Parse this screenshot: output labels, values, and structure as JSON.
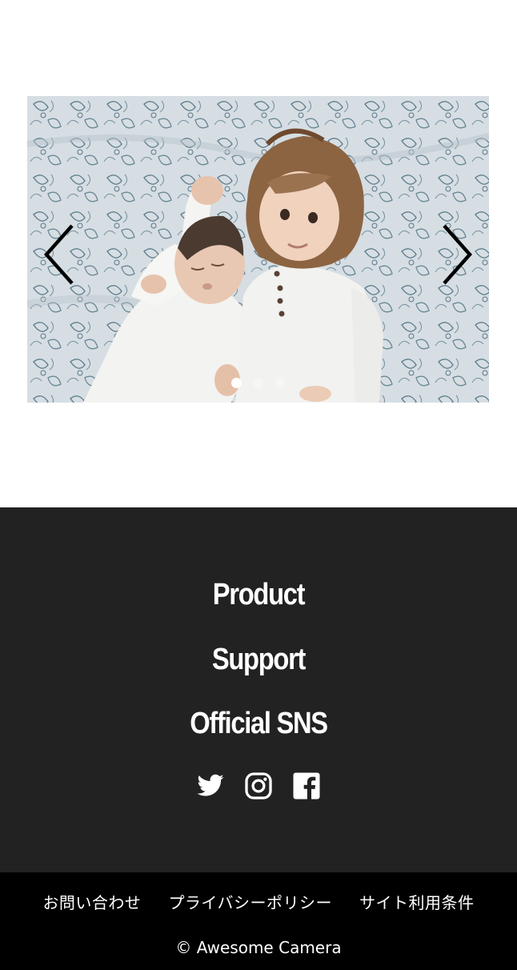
{
  "slider": {
    "image_alt": "Two children lying on a floral bedsheet",
    "prev_icon": "chevron-left-icon",
    "next_icon": "chevron-right-icon",
    "slide_count": 3,
    "active_slide": 1
  },
  "footer_nav": {
    "items": [
      {
        "label": "Product"
      },
      {
        "label": "Support"
      },
      {
        "label": "Official SNS"
      }
    ],
    "sns": [
      {
        "name": "twitter-icon"
      },
      {
        "name": "instagram-icon"
      },
      {
        "name": "facebook-icon"
      }
    ],
    "background": "#222222"
  },
  "bottom_bar": {
    "links": [
      {
        "label": "お問い合わせ"
      },
      {
        "label": "プライバシーポリシー"
      },
      {
        "label": "サイト利用条件"
      }
    ],
    "copyright": "© Awesome Camera",
    "background": "#000000"
  }
}
